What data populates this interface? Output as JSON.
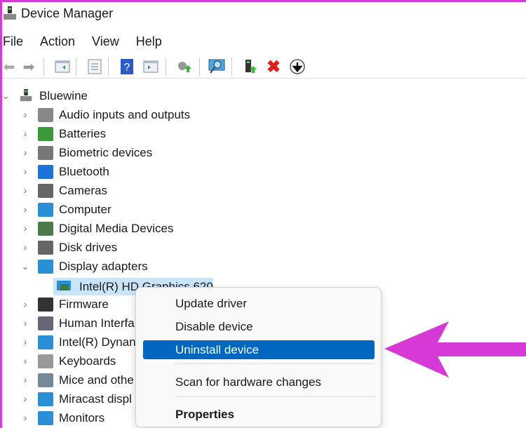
{
  "window": {
    "title": "Device Manager"
  },
  "menubar": [
    "File",
    "Action",
    "View",
    "Help"
  ],
  "toolbar": [
    "back-icon",
    "forward-icon",
    "show-hide-console-tree-icon",
    "properties-icon",
    "help-icon",
    "show-action-pane-icon",
    "update-driver-icon",
    "scan-hardware-icon",
    "enable-device-icon",
    "uninstall-icon",
    "disable-device-icon"
  ],
  "tree": {
    "root": "Bluewine",
    "categories": [
      {
        "label": "Audio inputs and outputs",
        "color": "#888"
      },
      {
        "label": "Batteries",
        "color": "#3a9a3a"
      },
      {
        "label": "Biometric devices",
        "color": "#777"
      },
      {
        "label": "Bluetooth",
        "color": "#1e73d8"
      },
      {
        "label": "Cameras",
        "color": "#666"
      },
      {
        "label": "Computer",
        "color": "#2a8fd6"
      },
      {
        "label": "Digital Media Devices",
        "color": "#4a7a4a"
      },
      {
        "label": "Disk drives",
        "color": "#666"
      },
      {
        "label": "Display adapters",
        "color": "#2a8fd6",
        "expanded": true
      },
      {
        "label": "Firmware",
        "color": "#333"
      },
      {
        "label": "Human Interfa",
        "color": "#667"
      },
      {
        "label": "Intel(R) Dynan",
        "color": "#2a8fd6"
      },
      {
        "label": "Keyboards",
        "color": "#999"
      },
      {
        "label": "Mice and othe",
        "color": "#789"
      },
      {
        "label": "Miracast displ",
        "color": "#2a8fd6"
      },
      {
        "label": "Monitors",
        "color": "#2a8fd6"
      }
    ],
    "selected_child": "Intel(R) HD Graphics 620"
  },
  "context_menu": {
    "items": [
      "Update driver",
      "Disable device",
      "Uninstall device",
      "Scan for hardware changes",
      "Properties"
    ],
    "highlighted": "Uninstall device"
  },
  "colors": {
    "highlight": "#0067c0",
    "annotation": "#d63ad6",
    "selection": "#cce4f7"
  }
}
